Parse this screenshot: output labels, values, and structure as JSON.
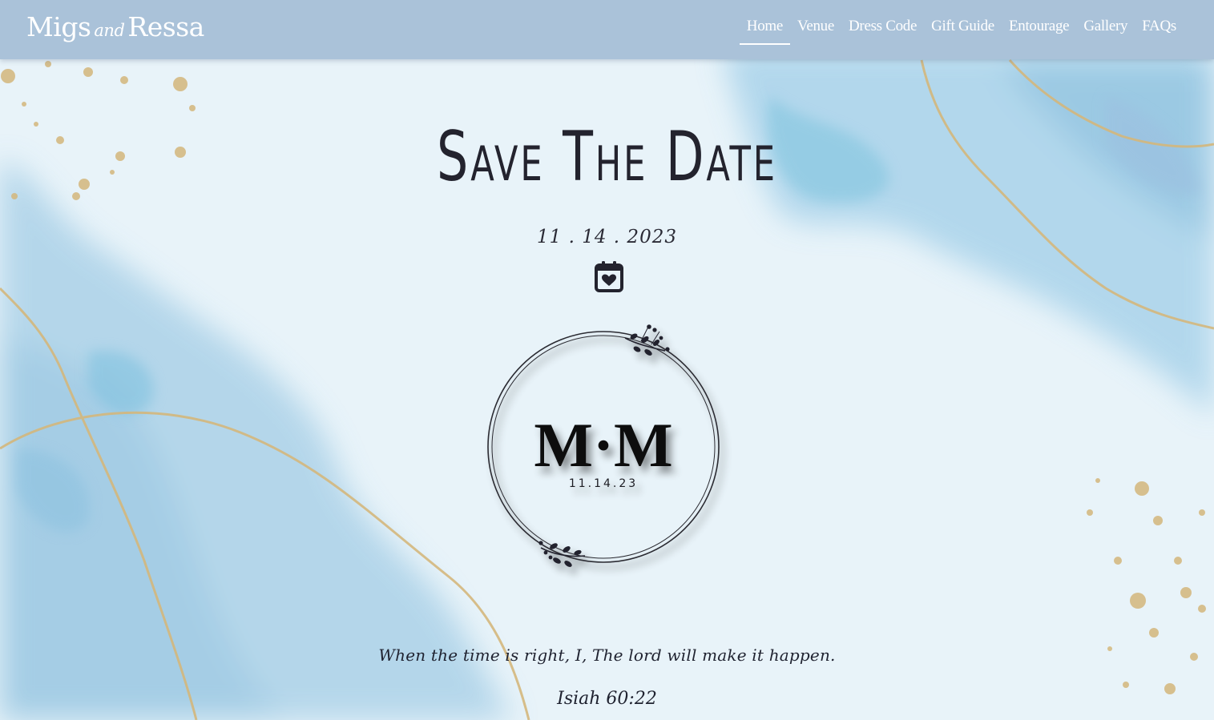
{
  "brand": {
    "name_first": "Migs",
    "name_and": "and",
    "name_second": "Ressa"
  },
  "nav": {
    "items": [
      {
        "label": "Home",
        "active": true
      },
      {
        "label": "Venue",
        "active": false
      },
      {
        "label": "Dress Code",
        "active": false
      },
      {
        "label": "Gift Guide",
        "active": false
      },
      {
        "label": "Entourage",
        "active": false
      },
      {
        "label": "Gallery",
        "active": false
      },
      {
        "label": "FAQs",
        "active": false
      }
    ]
  },
  "hero": {
    "title": "Save The Date",
    "date": "11 . 14 . 2023",
    "calendar_icon": "calendar-heart-icon"
  },
  "monogram": {
    "letters": "M·M",
    "date": "11.14.23"
  },
  "quote": {
    "text": "When the time is right, I, The lord will make it happen.",
    "verse": "Isiah 60:22"
  },
  "colors": {
    "navbar": "#aac2d9",
    "background": "#e6f2f8",
    "watercolor": "#9fcce4",
    "gold": "#d4b77c",
    "text": "#23232e"
  }
}
